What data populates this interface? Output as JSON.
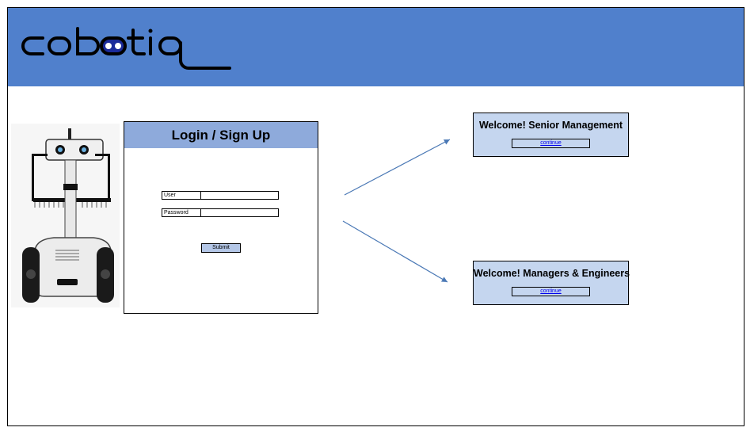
{
  "header": {
    "brand": "cobotiq",
    "background": "#5080cc"
  },
  "login": {
    "title": "Login / Sign Up",
    "user_label": "User",
    "user_value": "",
    "password_label": "Password",
    "password_value": "",
    "submit_label": "Submit",
    "header_color": "#8eaadb",
    "button_color": "#b4c7e7"
  },
  "destinations": [
    {
      "title": "Welcome! Senior Management",
      "link_label": "continue"
    },
    {
      "title": "Welcome! Managers & Engineers",
      "link_label": "continue"
    }
  ],
  "colors": {
    "arrow": "#4a78b5",
    "welcome_bg": "#c5d6ef"
  }
}
